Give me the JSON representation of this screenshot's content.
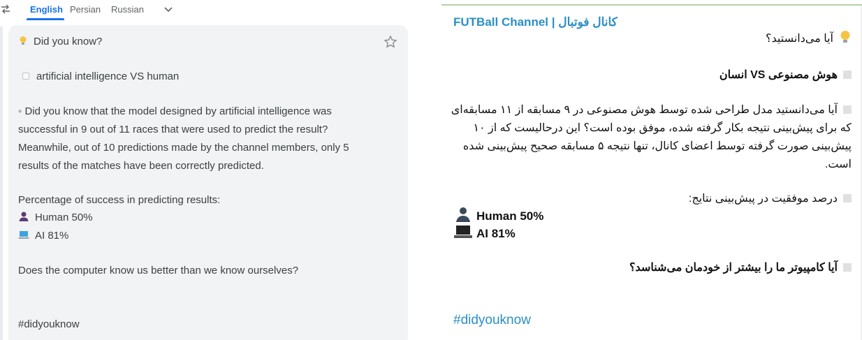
{
  "translator": {
    "languages": [
      {
        "label": "English",
        "active": true
      },
      {
        "label": "Persian",
        "active": false
      },
      {
        "label": "Russian",
        "active": false
      }
    ],
    "card": {
      "heading": "Did you know?",
      "topic": "artificial intelligence VS human",
      "body": "◦ Did you know that the model designed by artificial intelligence was successful in 9 out of 11 races that were used to predict the result? Meanwhile, out of 10 predictions made by the channel members, only 5 results of the matches have been correctly predicted.",
      "stats_title": "Percentage of success in predicting results:",
      "human": "Human 50%",
      "ai": "AI 81%",
      "question": "Does the computer know us better than we know ourselves?",
      "hashtag": "#didyouknow"
    }
  },
  "post": {
    "channel": "FUTBall Channel | کانال فوتبال",
    "heading": "آیا می‌دانستید؟",
    "topic": "هوش مصنوعی VS انسان",
    "body": "آیا می‌دانستید مدل طراحی شده توسط هوش مصنوعی در ۹ مسابقه از ۱۱ مسابقه‌ای که برای پیش‌بینی نتیجه بکار گرفته شده، موفق بوده است؟ این درحالیست که از ۱۰ پیش‌بینی صورت گرفته توسط اعضای کانال، تنها نتیجه ۵ مسابقه صحیح پیش‌بینی شده است.",
    "stats_title": "درصد موفقیت در پیش‌بینی نتایج:",
    "human": "Human 50%",
    "ai": "AI 81%",
    "question": "آیا کامپیوتر ما را بیشتر از خودمان می‌شناسد؟",
    "hashtag": "#didyouknow"
  },
  "colors": {
    "accent": "#1a73e8",
    "link": "#2a8fc6",
    "card_bg": "#f1f3f4"
  }
}
